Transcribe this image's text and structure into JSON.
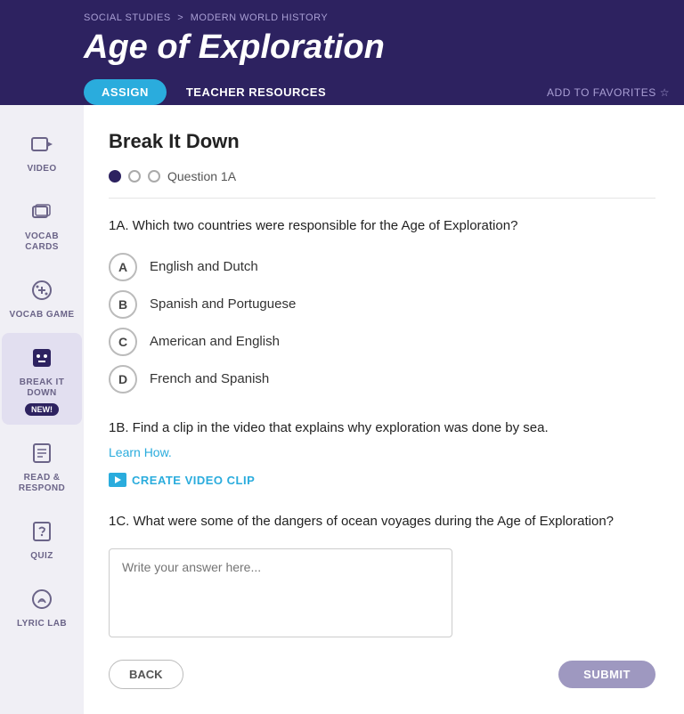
{
  "header": {
    "breadcrumb_part1": "SOCIAL STUDIES",
    "breadcrumb_sep": ">",
    "breadcrumb_part2": "MODERN WORLD HISTORY",
    "title": "Age of Exploration",
    "btn_assign": "ASSIGN",
    "btn_teacher": "TEACHER RESOURCES",
    "add_favorites": "ADD TO FAVORITES"
  },
  "sidebar": {
    "items": [
      {
        "id": "video",
        "label": "VIDEO",
        "active": false
      },
      {
        "id": "vocab-cards",
        "label": "VOCAB CARDS",
        "active": false
      },
      {
        "id": "vocab-game",
        "label": "VOCAB GAME",
        "active": false
      },
      {
        "id": "break-it-down",
        "label": "BREAK IT DOWN",
        "active": true,
        "badge": "NEW!"
      },
      {
        "id": "read-respond",
        "label": "READ & RESPOND",
        "active": false
      },
      {
        "id": "quiz",
        "label": "QUIZ",
        "active": false
      },
      {
        "id": "lyric-lab",
        "label": "LYRIC LAB",
        "active": false
      }
    ]
  },
  "content": {
    "section_title": "Break It Down",
    "progress_label": "Question 1A",
    "question_1a": "1A. Which two countries were responsible for the Age of Exploration?",
    "options": [
      {
        "letter": "A",
        "text": "English and Dutch"
      },
      {
        "letter": "B",
        "text": "Spanish and Portuguese"
      },
      {
        "letter": "C",
        "text": "American and English"
      },
      {
        "letter": "D",
        "text": "French and Spanish"
      }
    ],
    "question_1b": "1B. Find a clip in the video that explains why exploration was done by sea.",
    "learn_how": "Learn How.",
    "create_clip": "CREATE VIDEO CLIP",
    "question_1c": "1C. What were some of the dangers of ocean voyages during the Age of Exploration?",
    "textarea_placeholder": "Write your answer here...",
    "btn_back": "BACK",
    "btn_submit": "SUBMIT"
  }
}
